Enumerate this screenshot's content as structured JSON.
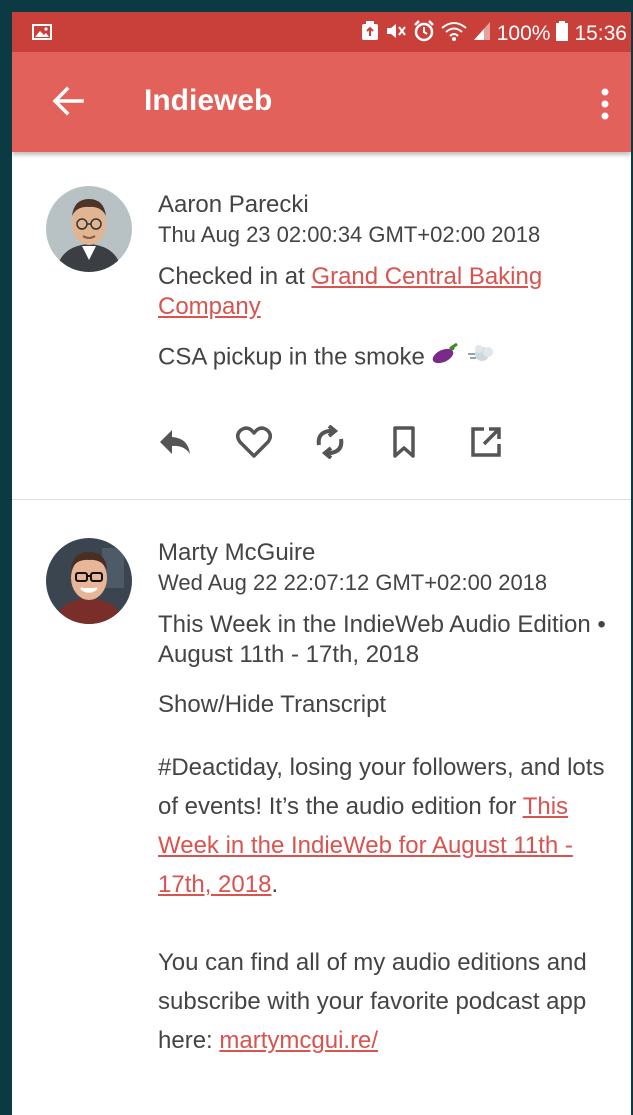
{
  "status_bar": {
    "battery": "100%",
    "time": "15:36"
  },
  "toolbar": {
    "title": "Indieweb"
  },
  "posts": [
    {
      "author": "Aaron Parecki",
      "date": "Thu Aug 23 02:00:34 GMT+02:00 2018",
      "checkin_prefix": "Checked in at ",
      "checkin_link": "Grand Central Baking Company",
      "content": "CSA pickup in the smoke",
      "actions": [
        "reply-icon",
        "like-icon",
        "repost-icon",
        "bookmark-icon",
        "external-link-icon"
      ]
    },
    {
      "author": "Marty McGuire",
      "date": "Wed Aug 22 22:07:12 GMT+02:00 2018",
      "title": "This Week in the IndieWeb Audio Edition • August 11th - 17th, 2018",
      "toggle": "Show/Hide Transcript",
      "p1_text": "#Deactiday, losing your followers, and lots of events! It’s the audio edition for ",
      "p1_link": "This Week in the IndieWeb for August 11th - 17th, 2018",
      "p1_end": ".",
      "p2_text": "You can find all of my audio editions and subscribe with your favorite podcast app here: ",
      "p2_link": "martymcgui.re/"
    }
  ],
  "colors": {
    "toolbar": "#e2615b",
    "statusbar": "#c9403a",
    "link": "#d9534f"
  }
}
